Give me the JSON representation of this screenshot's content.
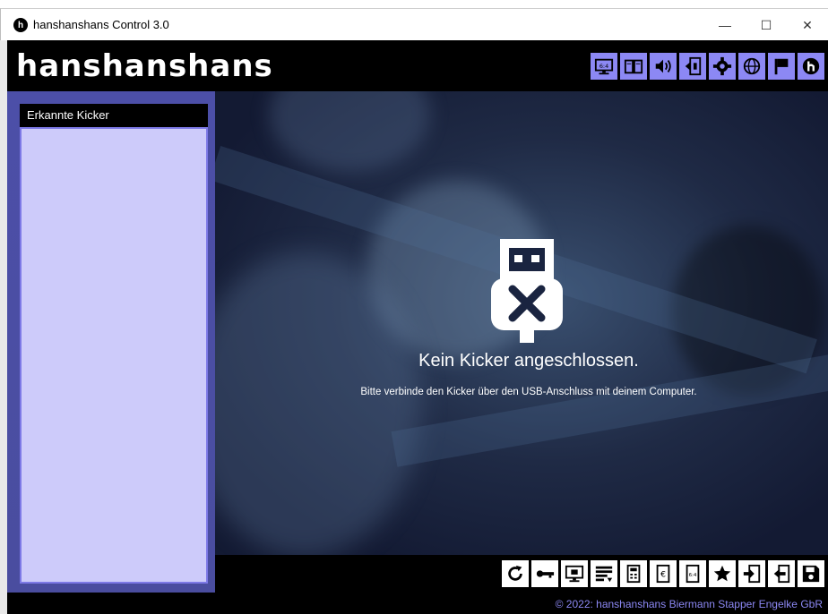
{
  "window": {
    "title": "hanshanshans Control 3.0",
    "controls": {
      "minimize": "—",
      "maximize": "☐",
      "close": "✕"
    }
  },
  "header": {
    "logo_text": "hanshanshans",
    "toolbar_icons": [
      "scoreboard-icon",
      "book-icon",
      "speaker-icon",
      "door-exit-icon",
      "gear-icon",
      "globe-icon",
      "flag-icon",
      "logo-h-icon"
    ]
  },
  "sidebar": {
    "header_label": "Erkannte Kicker",
    "items": []
  },
  "main": {
    "icon": "usb-disconnected-icon",
    "title": "Kein Kicker angeschlossen.",
    "subtitle": "Bitte verbinde den Kicker über den USB-Anschluss mit deinem Computer."
  },
  "bottom_toolbar": {
    "icons": [
      "refresh-icon",
      "key-icon",
      "monitor-icon",
      "list-icon",
      "calculator-icon",
      "euro-device-icon",
      "score-device-icon",
      "star-icon",
      "import-icon",
      "export-icon",
      "save-icon"
    ]
  },
  "footer": {
    "copyright": "© 2022: hanshanshans Biermann Stapper Engelke GbR"
  },
  "colors": {
    "accent": "#8c88f4",
    "sidebar_bg": "#4c4fa8",
    "list_bg": "#cdcbfa"
  }
}
